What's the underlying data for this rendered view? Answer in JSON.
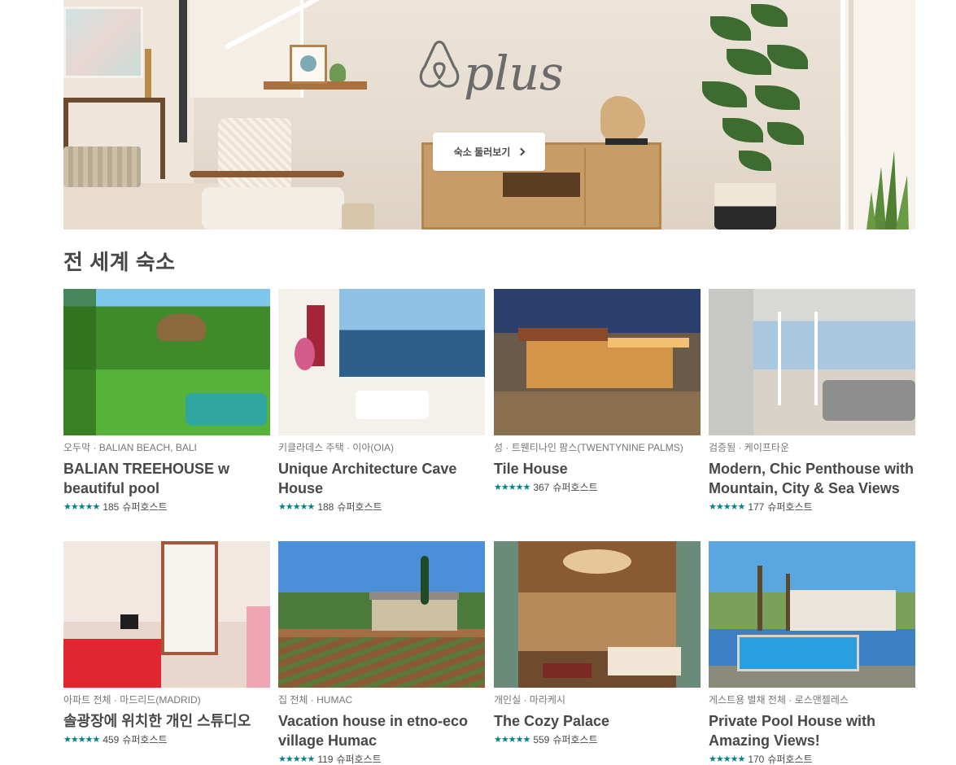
{
  "hero": {
    "logo_text": "plus",
    "button_label": "숙소 둘러보기",
    "button_icon": "chevron-right-icon"
  },
  "section": {
    "title": "전 세계 숙소"
  },
  "rating_color": "#008489",
  "star_glyphs": "★★★★★",
  "listings": [
    {
      "kicker": "오두막 · BALIAN BEACH, BALI",
      "title": "BALIAN TREEHOUSE w beautiful pool",
      "reviews": "185",
      "badge": "슈퍼호스트"
    },
    {
      "kicker": "키클라데스 주택 · 이아(OIA)",
      "title": "Unique Architecture Cave House",
      "reviews": "188",
      "badge": "슈퍼호스트"
    },
    {
      "kicker": "성 · 트웬티나인 팜스(TWENTYNINE PALMS)",
      "title": "Tile House",
      "reviews": "367",
      "badge": "슈퍼호스트"
    },
    {
      "kicker": "검증됨 · 케이프타운",
      "title": "Modern, Chic Penthouse with Mountain, City & Sea Views",
      "reviews": "177",
      "badge": "슈퍼호스트"
    },
    {
      "kicker": "아파트 전체 · 마드리드(MADRID)",
      "title": "솔광장에 위치한 개인 스튜디오",
      "reviews": "459",
      "badge": "슈퍼호스트"
    },
    {
      "kicker": "집 전체 · HUMAC",
      "title": "Vacation house in etno-eco village Humac",
      "reviews": "119",
      "badge": "슈퍼호스트"
    },
    {
      "kicker": "개인실 · 마라케시",
      "title": "The Cozy Palace",
      "reviews": "559",
      "badge": "슈퍼호스트"
    },
    {
      "kicker": "게스트용 별채 전체 · 로스앤젤레스",
      "title": "Private Pool House with Amazing Views!",
      "reviews": "170",
      "badge": "슈퍼호스트"
    }
  ]
}
